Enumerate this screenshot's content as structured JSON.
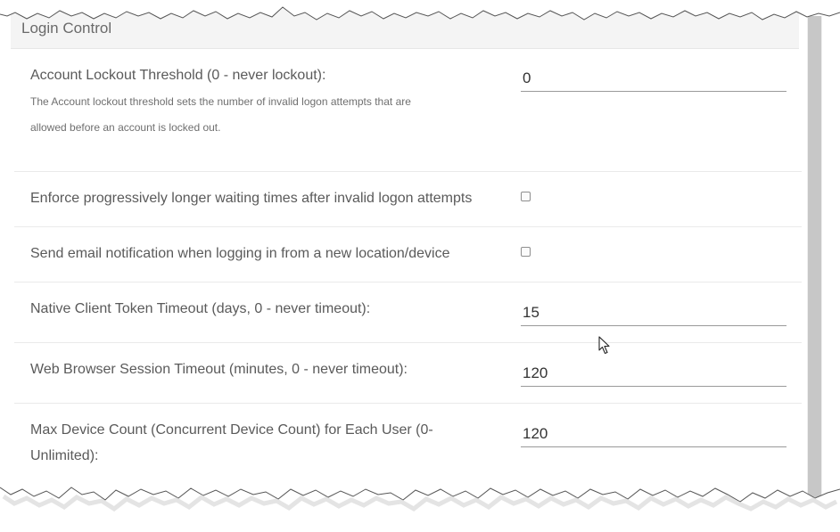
{
  "section": {
    "title": "Login Control"
  },
  "settings": [
    {
      "label": "Account Lockout Threshold (0 - never lockout):",
      "hint_line1": "The Account lockout threshold sets the number of invalid logon attempts that are",
      "hint_line2": "allowed before an account is locked out.",
      "value": "0"
    },
    {
      "label": "Enforce progressively longer waiting times after invalid logon attempts",
      "checked": false
    },
    {
      "label": "Send email notification when logging in from a new location/device",
      "checked": false
    },
    {
      "label": "Native Client Token Timeout (days, 0 - never timeout):",
      "value": "15"
    },
    {
      "label": "Web Browser Session Timeout (minutes, 0 - never timeout):",
      "value": "120"
    },
    {
      "label_line1": "Max Device Count (Concurrent Device Count) for Each User (0-",
      "label_line2": "Unlimited):",
      "value": "120"
    }
  ]
}
